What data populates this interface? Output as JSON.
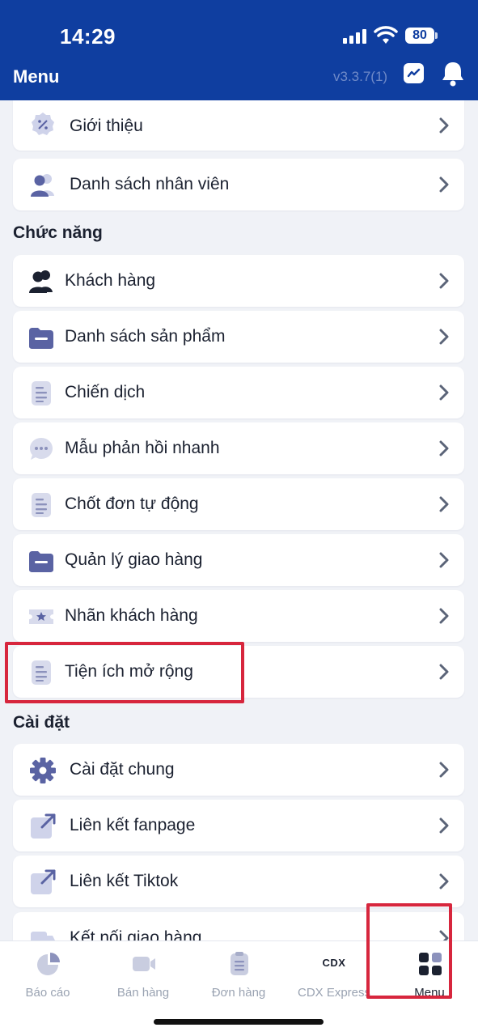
{
  "status_bar": {
    "time": "14:29",
    "battery": "80"
  },
  "header": {
    "title": "Menu",
    "version": "v3.3.7(1)"
  },
  "top_items": [
    {
      "label": "Giới thiệu",
      "icon": "badge-percent-icon"
    },
    {
      "label": "Danh sách nhân viên",
      "icon": "users-icon"
    }
  ],
  "sections": [
    {
      "title": "Chức năng",
      "items": [
        {
          "label": "Khách hàng",
          "icon": "users-icon"
        },
        {
          "label": "Danh sách sản phẩm",
          "icon": "folder-icon"
        },
        {
          "label": "Chiến dịch",
          "icon": "document-icon"
        },
        {
          "label": "Mẫu phản hồi nhanh",
          "icon": "chat-bubble-icon"
        },
        {
          "label": "Chốt đơn tự động",
          "icon": "document-icon"
        },
        {
          "label": "Quản lý giao hàng",
          "icon": "folder-icon"
        },
        {
          "label": "Nhãn khách hàng",
          "icon": "ticket-star-icon"
        },
        {
          "label": "Tiện ích mở rộng",
          "icon": "document-icon"
        }
      ]
    },
    {
      "title": "Cài đặt",
      "items": [
        {
          "label": "Cài đặt chung",
          "icon": "gear-icon"
        },
        {
          "label": "Liên kết fanpage",
          "icon": "external-link-icon"
        },
        {
          "label": "Liên kết Tiktok",
          "icon": "external-link-icon"
        },
        {
          "label": "Kết nối giao hàng",
          "icon": "truck-icon"
        }
      ]
    }
  ],
  "tabbar": [
    {
      "label": "Báo cáo",
      "icon": "pie-chart-icon"
    },
    {
      "label": "Bán hàng",
      "icon": "video-icon"
    },
    {
      "label": "Đơn hàng",
      "icon": "clipboard-icon"
    },
    {
      "label": "CDX Express",
      "icon": "cdx-logo-icon",
      "logo_text": "CDX"
    },
    {
      "label": "Menu",
      "icon": "grid-icon",
      "active": true
    }
  ],
  "colors": {
    "header": "#0f3ea0",
    "icon": "#5a63a3",
    "highlight": "#d7263d"
  }
}
